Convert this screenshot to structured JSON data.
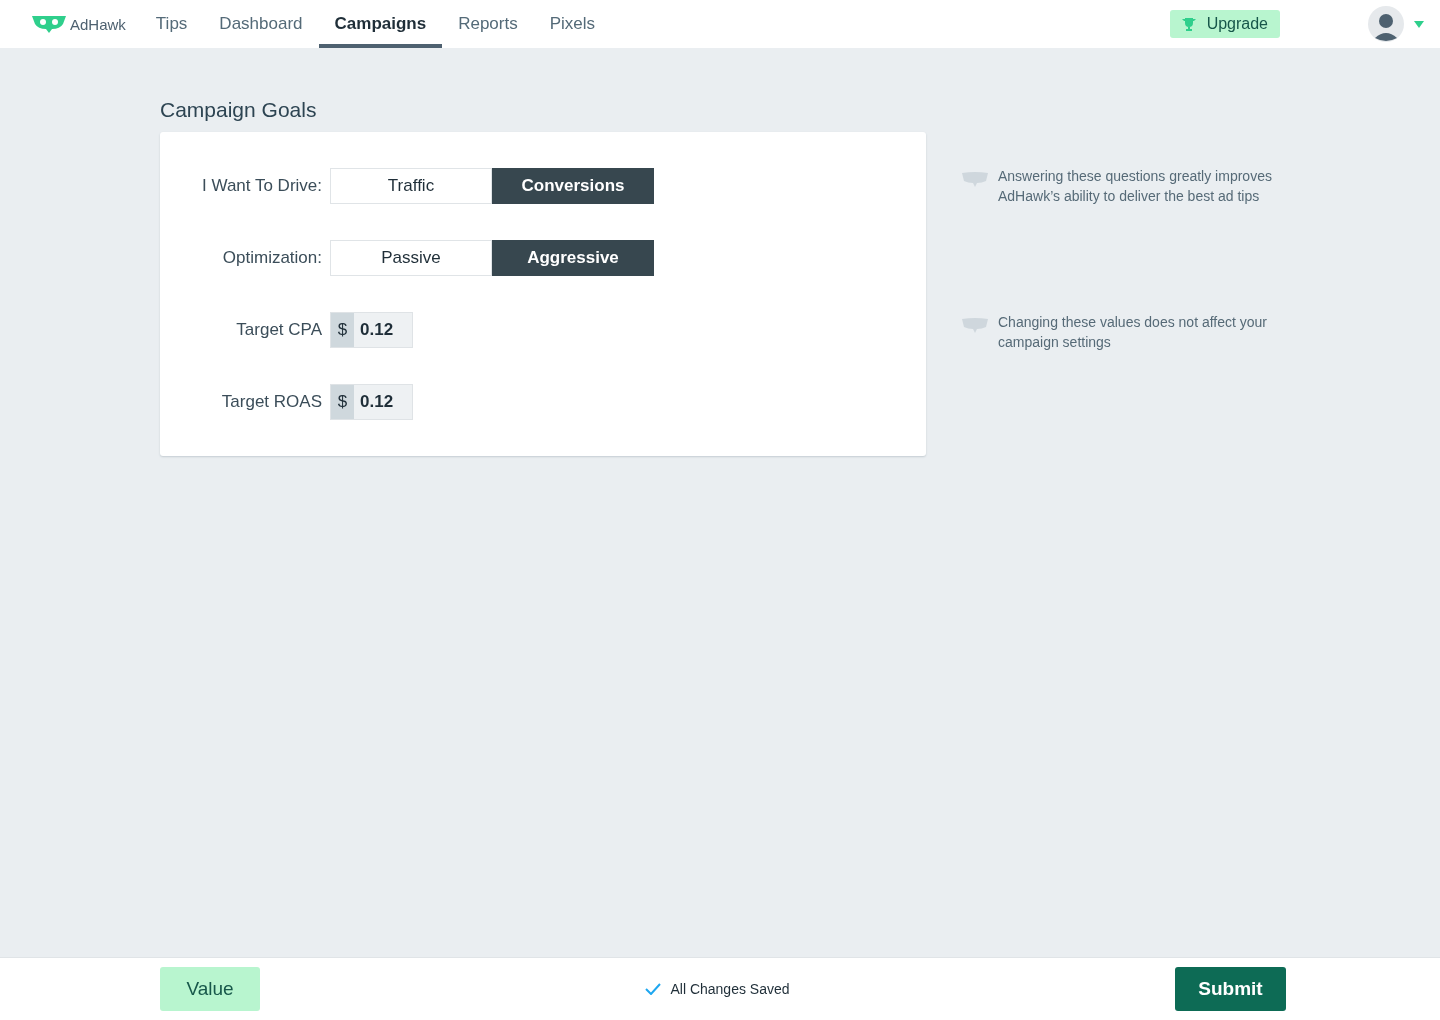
{
  "nav": {
    "brand": "AdHawk",
    "tabs": [
      {
        "label": "Tips",
        "selected": false
      },
      {
        "label": "Dashboard",
        "selected": false
      },
      {
        "label": "Campaigns",
        "selected": true
      },
      {
        "label": "Reports",
        "selected": false
      },
      {
        "label": "Pixels",
        "selected": false
      }
    ],
    "upgrade": "Upgrade"
  },
  "page_title": "Campaign Goals",
  "fields": [
    {
      "kind": "toggle",
      "label": "I Want To Drive:",
      "options": [
        {
          "label": "Traffic",
          "selected": false
        },
        {
          "label": "Conversions",
          "selected": true
        }
      ]
    },
    {
      "kind": "toggle",
      "label": "Optimization:",
      "options": [
        {
          "label": "Passive",
          "selected": false
        },
        {
          "label": "Aggressive",
          "selected": true
        }
      ]
    },
    {
      "kind": "currency",
      "label": "Target CPA",
      "prefix": "$",
      "value": "0.12"
    },
    {
      "kind": "currency",
      "label": "Target ROAS",
      "prefix": "$",
      "value": "0.12"
    }
  ],
  "tips": [
    "Answering these questions greatly improves AdHawk’s ability to deliver the best ad tips",
    "Changing these values does not affect your campaign settings"
  ],
  "footer": {
    "left_button": "Value",
    "status": "All Changes Saved",
    "submit": "Submit"
  }
}
